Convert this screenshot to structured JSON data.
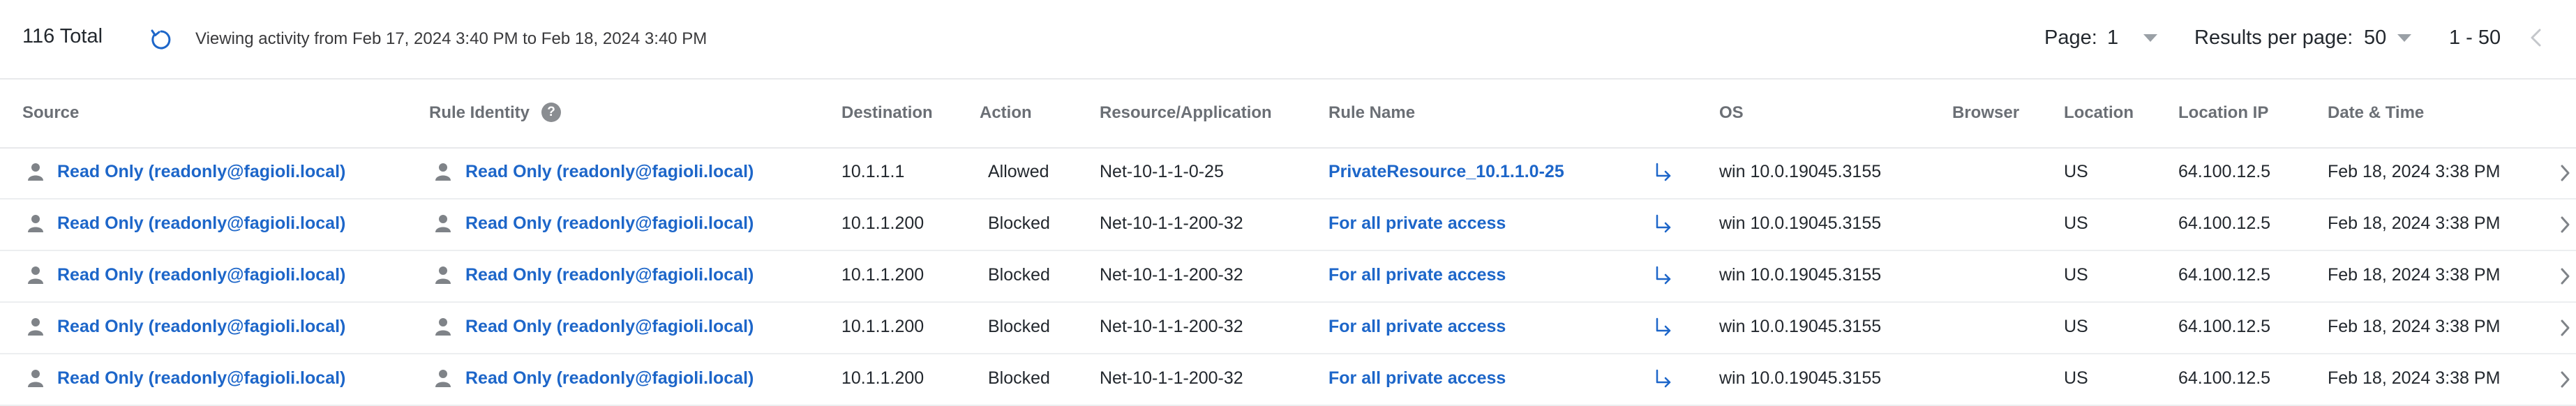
{
  "toolbar": {
    "total": "116 Total",
    "viewing": "Viewing activity from Feb 17, 2024 3:40 PM to Feb 18, 2024 3:40 PM",
    "page_label": "Page:",
    "page_value": "1",
    "rpp_label": "Results per page:",
    "rpp_value": "50",
    "range": "1 - 50"
  },
  "table": {
    "headers": {
      "source": "Source",
      "rule_identity": "Rule Identity",
      "destination": "Destination",
      "action": "Action",
      "resource": "Resource/Application",
      "rule_name": "Rule Name",
      "os": "OS",
      "browser": "Browser",
      "location": "Location",
      "location_ip": "Location IP",
      "datetime": "Date & Time"
    },
    "rows": [
      {
        "source": "Read Only (readonly@fagioli.local)",
        "identity": "Read Only (readonly@fagioli.local)",
        "destination": "10.1.1.1",
        "action": "Allowed",
        "resource": "Net-10-1-1-0-25",
        "rule_name": "PrivateResource_10.1.1.0-25",
        "os": "win 10.0.19045.3155",
        "browser": "",
        "location": "US",
        "location_ip": "64.100.12.5",
        "datetime": "Feb 18, 2024 3:38 PM"
      },
      {
        "source": "Read Only (readonly@fagioli.local)",
        "identity": "Read Only (readonly@fagioli.local)",
        "destination": "10.1.1.200",
        "action": "Blocked",
        "resource": "Net-10-1-1-200-32",
        "rule_name": "For all private access",
        "os": "win 10.0.19045.3155",
        "browser": "",
        "location": "US",
        "location_ip": "64.100.12.5",
        "datetime": "Feb 18, 2024 3:38 PM"
      },
      {
        "source": "Read Only (readonly@fagioli.local)",
        "identity": "Read Only (readonly@fagioli.local)",
        "destination": "10.1.1.200",
        "action": "Blocked",
        "resource": "Net-10-1-1-200-32",
        "rule_name": "For all private access",
        "os": "win 10.0.19045.3155",
        "browser": "",
        "location": "US",
        "location_ip": "64.100.12.5",
        "datetime": "Feb 18, 2024 3:38 PM"
      },
      {
        "source": "Read Only (readonly@fagioli.local)",
        "identity": "Read Only (readonly@fagioli.local)",
        "destination": "10.1.1.200",
        "action": "Blocked",
        "resource": "Net-10-1-1-200-32",
        "rule_name": "For all private access",
        "os": "win 10.0.19045.3155",
        "browser": "",
        "location": "US",
        "location_ip": "64.100.12.5",
        "datetime": "Feb 18, 2024 3:38 PM"
      },
      {
        "source": "Read Only (readonly@fagioli.local)",
        "identity": "Read Only (readonly@fagioli.local)",
        "destination": "10.1.1.200",
        "action": "Blocked",
        "resource": "Net-10-1-1-200-32",
        "rule_name": "For all private access",
        "os": "win 10.0.19045.3155",
        "browser": "",
        "location": "US",
        "location_ip": "64.100.12.5",
        "datetime": "Feb 18, 2024 3:38 PM"
      }
    ]
  },
  "colors": {
    "link": "#1d66c9",
    "header_text": "#6b6f75",
    "divider": "#e8e9eb"
  },
  "icons": [
    "refresh-icon",
    "help-icon",
    "caret-down-icon",
    "chevron-left-icon",
    "person-icon",
    "rule-jump-arrow-icon",
    "chevron-right-icon"
  ]
}
